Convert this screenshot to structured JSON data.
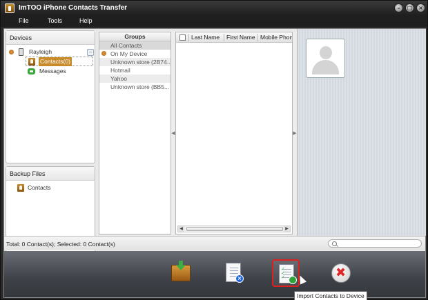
{
  "window": {
    "title": "ImTOO iPhone Contacts Transfer"
  },
  "menu": {
    "items": [
      "File",
      "Tools",
      "Help"
    ]
  },
  "devices": {
    "header": "Devices",
    "device_name": "Rayleigh",
    "items": [
      {
        "label": "Contacts(0)",
        "selected": true
      },
      {
        "label": "Messages",
        "selected": false
      }
    ]
  },
  "backup": {
    "header": "Backup Files",
    "items": [
      {
        "label": "Contacts"
      }
    ]
  },
  "groups": {
    "header": "Groups",
    "rows": [
      {
        "label": "All Contacts",
        "selected": true
      },
      {
        "label": "On My Device",
        "icon": "device-dot-icon"
      },
      {
        "label": "Unknown store (2B74..."
      },
      {
        "label": "Hotmail"
      },
      {
        "label": "Yahoo"
      },
      {
        "label": "Unknown store (BB5..."
      }
    ]
  },
  "contacts_list": {
    "columns": [
      "Last Name",
      "First Name",
      "Mobile Phone"
    ]
  },
  "status": {
    "text": "Total: 0 Contact(s); Selected: 0 Contact(s)",
    "search_placeholder": ""
  },
  "toolbar": {
    "buttons": [
      {
        "name": "export-contacts",
        "icon": "box-download-icon"
      },
      {
        "name": "export-contacts-to-file",
        "icon": "doc-export-icon"
      },
      {
        "name": "import-contacts-to-device",
        "icon": "doc-import-icon",
        "selected": true
      },
      {
        "name": "delete-contacts",
        "icon": "delete-icon"
      }
    ],
    "tooltip": "Import Contacts to Device"
  },
  "colors": {
    "selection_highlight": "#e02020",
    "accent_orange": "#c98a2a",
    "toolbar_bg": "#3e4248"
  }
}
